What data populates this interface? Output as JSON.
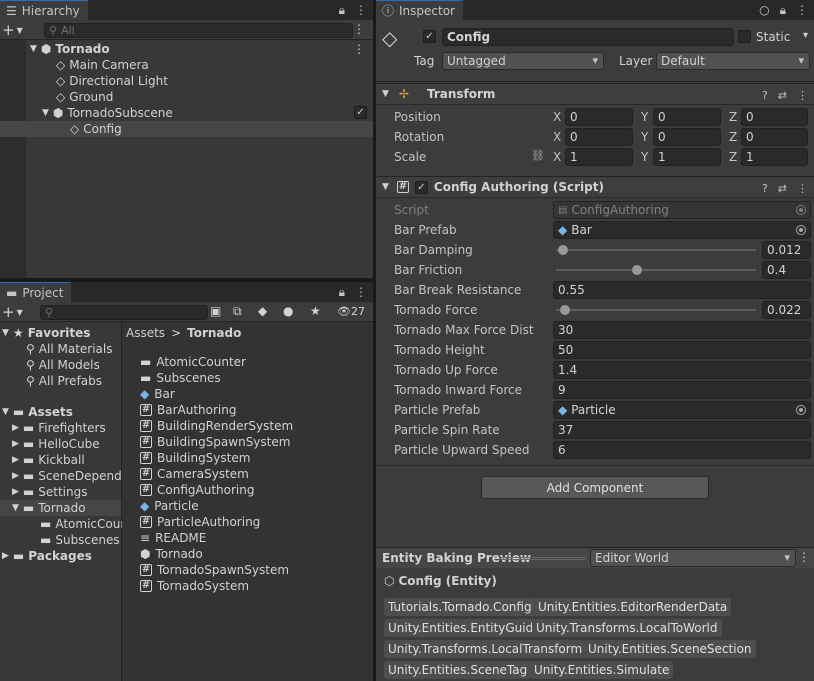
{
  "hierarchy": {
    "tab_label": "Hierarchy",
    "search_placeholder": "All",
    "items": [
      {
        "label": "Tornado"
      },
      {
        "label": "Main Camera"
      },
      {
        "label": "Directional Light"
      },
      {
        "label": "Ground"
      },
      {
        "label": "TornadoSubscene"
      },
      {
        "label": "Config"
      }
    ]
  },
  "project": {
    "tab_label": "Project",
    "hidden_count": "27",
    "favorites_label": "Favorites",
    "favorites": [
      "All Materials",
      "All Models",
      "All Prefabs"
    ],
    "assets_label": "Assets",
    "asset_folders": [
      "Firefighters",
      "HelloCube",
      "Kickball",
      "SceneDependency",
      "Settings",
      "Tornado"
    ],
    "tornado_children": [
      "AtomicCounter",
      "Subscenes"
    ],
    "packages_label": "Packages",
    "breadcrumb": [
      "Assets",
      "Tornado"
    ],
    "breadcrumb_sep": ">",
    "files": [
      {
        "name": "AtomicCounter",
        "icon": "folder-icon"
      },
      {
        "name": "Subscenes",
        "icon": "folder-icon"
      },
      {
        "name": "Bar",
        "icon": "prefab-icon"
      },
      {
        "name": "BarAuthoring",
        "icon": "script-icon"
      },
      {
        "name": "BuildingRenderSystem",
        "icon": "script-icon"
      },
      {
        "name": "BuildingSpawnSystem",
        "icon": "script-icon"
      },
      {
        "name": "BuildingSystem",
        "icon": "script-icon"
      },
      {
        "name": "CameraSystem",
        "icon": "script-icon"
      },
      {
        "name": "ConfigAuthoring",
        "icon": "script-icon"
      },
      {
        "name": "Particle",
        "icon": "prefab-icon"
      },
      {
        "name": "ParticleAuthoring",
        "icon": "script-icon"
      },
      {
        "name": "README",
        "icon": "text-icon"
      },
      {
        "name": "Tornado",
        "icon": "scene-icon"
      },
      {
        "name": "TornadoSpawnSystem",
        "icon": "script-icon"
      },
      {
        "name": "TornadoSystem",
        "icon": "script-icon"
      }
    ]
  },
  "inspector": {
    "tab_label": "Inspector",
    "object_name": "Config",
    "static_label": "Static",
    "tag_label": "Tag",
    "tag_value": "Untagged",
    "layer_label": "Layer",
    "layer_value": "Default",
    "transform": {
      "title": "Transform",
      "rows": [
        {
          "label": "Position",
          "x": "0",
          "y": "0",
          "z": "0"
        },
        {
          "label": "Rotation",
          "x": "0",
          "y": "0",
          "z": "0"
        },
        {
          "label": "Scale",
          "x": "1",
          "y": "1",
          "z": "1"
        }
      ],
      "axis_x": "X",
      "axis_y": "Y",
      "axis_z": "Z"
    },
    "config": {
      "title": "Config Authoring (Script)",
      "script_label": "Script",
      "script_value": "ConfigAuthoring",
      "bar_prefab_label": "Bar Prefab",
      "bar_prefab_value": "Bar",
      "bar_damping_label": "Bar Damping",
      "bar_damping_value": "0.012",
      "bar_damping_level": 0.012,
      "bar_friction_label": "Bar Friction",
      "bar_friction_value": "0.4",
      "bar_friction_level": 0.4,
      "bar_break_label": "Bar Break Resistance",
      "bar_break_value": "0.55",
      "tornado_force_label": "Tornado Force",
      "tornado_force_value": "0.022",
      "tornado_force_level": 0.022,
      "tornado_max_label": "Tornado Max Force Dist",
      "tornado_max_value": "30",
      "tornado_height_label": "Tornado Height",
      "tornado_height_value": "50",
      "tornado_up_label": "Tornado Up Force",
      "tornado_up_value": "1.4",
      "tornado_inward_label": "Tornado Inward Force",
      "tornado_inward_value": "9",
      "particle_prefab_label": "Particle Prefab",
      "particle_prefab_value": "Particle",
      "particle_spin_label": "Particle Spin Rate",
      "particle_spin_value": "37",
      "particle_upward_label": "Particle Upward Speed",
      "particle_upward_value": "6"
    },
    "add_component": "Add Component",
    "baking": {
      "title": "Entity Baking Preview",
      "world": "Editor World",
      "entity": "Config (Entity)",
      "components": [
        "Tutorials.Tornado.Config",
        "Unity.Entities.EditorRenderData",
        "Unity.Entities.EntityGuid",
        "Unity.Transforms.LocalToWorld",
        "Unity.Transforms.LocalTransform",
        "Unity.Entities.SceneSection",
        "Unity.Entities.SceneTag",
        "Unity.Entities.Simulate"
      ]
    }
  },
  "colors": {
    "accent": "#2c6bc1",
    "panel": "#383838",
    "field": "#2a2a2a",
    "selection": "#464646"
  }
}
